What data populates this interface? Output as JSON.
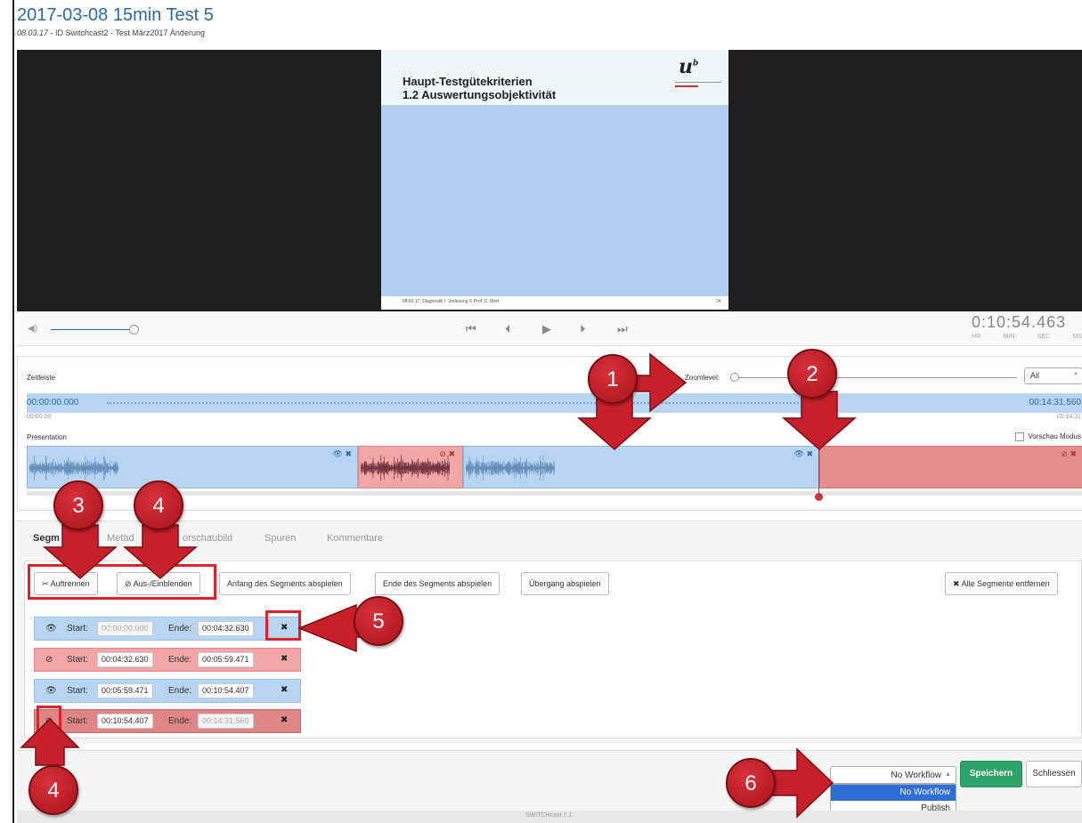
{
  "header": {
    "title": "2017-03-08 15min Test 5",
    "subtitle_date": "08.03.17",
    "subtitle_rest": " - ID Switchcast2 - Test März2017 Änderung"
  },
  "slide": {
    "title_line1": "Haupt-Testgütekriterien",
    "title_line2": "1.2 Auswertungsobjektivität",
    "logo": "u",
    "logo_sup": "b",
    "footer": "08.03.17, Diagnostik I: Vorlesung   © Prof. C. Morf",
    "page": "24"
  },
  "player": {
    "volume_level": 0.95,
    "time_display": "0:10:54.463",
    "time_labels": [
      "HR",
      "MIN",
      "SEC",
      "MS"
    ]
  },
  "timeline": {
    "label": "Zeitleiste",
    "zoom_label": "Zoomlevel:",
    "zoom_select": "All",
    "start_time": "00:00:00.000",
    "end_time": "00:14:31.560",
    "start_short": "00:00:00",
    "end_short": "00:14:31",
    "track_label": "Presentation",
    "preview_mode": "Vorschau Modus"
  },
  "tabs": [
    "Segmente",
    "Metadaten",
    "Vorschaubild",
    "Spuren",
    "Kommentare"
  ],
  "tabs_visible": [
    "Segm",
    "Metad",
    "orschaubild",
    "Spuren",
    "Kommentare"
  ],
  "toolbar": {
    "split": "Auftrennen",
    "toggle": "Aus-/Einblenden",
    "play_start": "Anfang des Segments abspielen",
    "play_end": "Ende des Segments abspielen",
    "play_transition": "Übergang abspielen",
    "remove_all": "Alle Segmente entfernen"
  },
  "segment_labels": {
    "start": "Start:",
    "end": "Ende:"
  },
  "segments": [
    {
      "start": "00:00:00.000",
      "end": "00:04:32.630",
      "state": "visible"
    },
    {
      "start": "00:04:32.630",
      "end": "00:05:59.471",
      "state": "hidden"
    },
    {
      "start": "00:05:59.471",
      "end": "00:10:54.407",
      "state": "visible"
    },
    {
      "start": "00:10:54.407",
      "end": "00:14:31.560",
      "state": "hidden"
    }
  ],
  "footer": {
    "workflow_selected": "No Workflow",
    "workflow_options": [
      "No Workflow",
      "Publish"
    ],
    "save": "Speichern",
    "close": "Schliessen",
    "version": "SWITCHcast 7.1"
  },
  "annotations": {
    "badges": [
      "1",
      "2",
      "3",
      "4",
      "4",
      "5",
      "6"
    ],
    "color": "#c8202a"
  }
}
